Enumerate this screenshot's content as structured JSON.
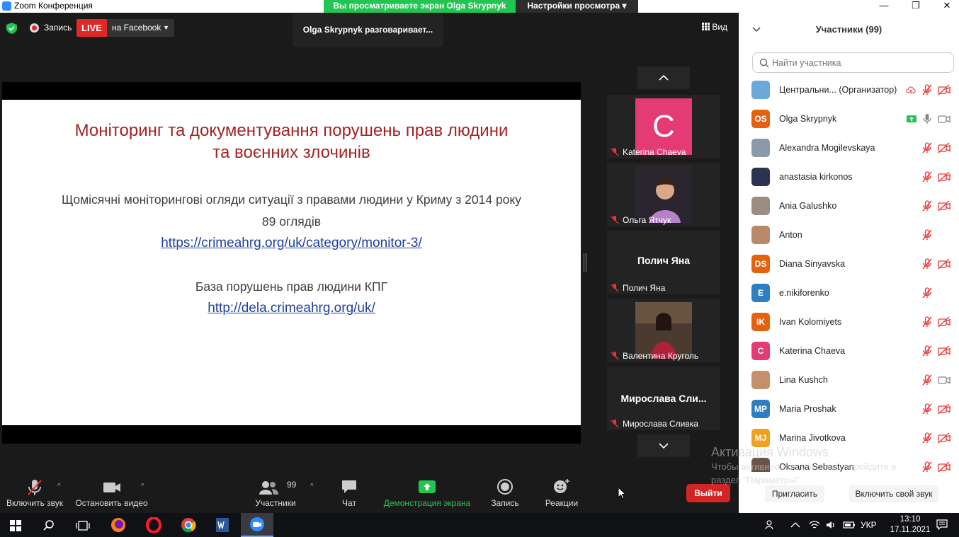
{
  "window": {
    "title": "Zoom Конференция",
    "viewing_banner": "Вы просматриваете экран Olga Skrypnyk",
    "view_options": "Настройки просмотра ▾",
    "minimize": "—",
    "maximize": "❐",
    "close": "✕"
  },
  "header": {
    "record_label": "Запись",
    "live_label": "LIVE",
    "live_target": "на Facebook",
    "speaking": "Olga Skrypnyk разговаривает...",
    "view_label": "Вид"
  },
  "slide": {
    "title_line1": "Моніторинг та документування порушень прав людини",
    "title_line2": "та воєнних злочинів",
    "line1": "Щомісячні моніторингові огляди ситуації з правами людини у Криму з 2014 року",
    "line2": "89 оглядів",
    "link1": "https://crimeahrg.org/uk/category/monitor-3/",
    "line3": "База порушень прав людини КПГ",
    "link2": "http://dela.crimeahrg.org/uk/"
  },
  "gallery": {
    "tiles": [
      {
        "name": "Katerina Chaeva",
        "avatar_letter": "C",
        "avatar_color": "#e43b75"
      },
      {
        "name": "Ольга Ятчук"
      },
      {
        "name": "Полич Яна",
        "big_label": "Полич Яна"
      },
      {
        "name": "Валентина Круголь"
      },
      {
        "name": "Мирослава Сливка",
        "big_label": "Мирослава  Сли..."
      }
    ]
  },
  "toolbar": {
    "unmute": "Включить звук",
    "stop_video": "Остановить видео",
    "participants": "Участники",
    "participants_count": "99",
    "chat": "Чат",
    "share": "Демонстрация экрана",
    "record": "Запись",
    "reactions": "Реакции",
    "leave": "Выйти"
  },
  "activation": {
    "title": "Активация Windows",
    "line1": "Чтобы активировать Windows, перейдите в",
    "line2": "раздел \"Параметры\"."
  },
  "panel": {
    "title": "Участники (99)",
    "search_placeholder": "Найти участника",
    "invite": "Пригласить",
    "unmute_me": "Включить свой звук",
    "participants": [
      {
        "name": "Центральни... (Организатор)",
        "initials": "",
        "color": "#6aa9d8",
        "mic": "muted",
        "video": "off",
        "cloud": true
      },
      {
        "name": "Olga Skrypnyk",
        "initials": "OS",
        "color": "#e4620f",
        "mic": "on",
        "video": "on",
        "share": true
      },
      {
        "name": "Alexandra Mogilevskaya",
        "initials": "",
        "color": "#8a9aa8",
        "mic": "muted",
        "video": "off"
      },
      {
        "name": "anastasia kirkonos",
        "initials": "",
        "color": "#2a3450",
        "mic": "muted",
        "video": "off"
      },
      {
        "name": "Ania Galushko",
        "initials": "",
        "color": "#9b8e80",
        "mic": "muted",
        "video": "off"
      },
      {
        "name": "Anton",
        "initials": "",
        "color": "#b98a6a",
        "mic": "muted",
        "video": "none"
      },
      {
        "name": "Diana Sinyavska",
        "initials": "DS",
        "color": "#e4620f",
        "mic": "muted",
        "video": "off"
      },
      {
        "name": "e.nikiforenko",
        "initials": "E",
        "color": "#2d7fc1",
        "mic": "muted",
        "video": "none"
      },
      {
        "name": "Ivan Kolomiyets",
        "initials": "IK",
        "color": "#e4620f",
        "mic": "muted",
        "video": "off"
      },
      {
        "name": "Katerina Chaeva",
        "initials": "C",
        "color": "#e43b75",
        "mic": "muted",
        "video": "off"
      },
      {
        "name": "Lina Kushch",
        "initials": "",
        "color": "#c48f6a",
        "mic": "muted",
        "video": "on"
      },
      {
        "name": "Maria Proshak",
        "initials": "MP",
        "color": "#2d7fc1",
        "mic": "muted",
        "video": "off"
      },
      {
        "name": "Marina Jivotkova",
        "initials": "MJ",
        "color": "#f0a020",
        "mic": "muted",
        "video": "off"
      },
      {
        "name": "Oksana Sebastyan",
        "initials": "",
        "color": "#6b5548",
        "mic": "muted",
        "video": "off"
      }
    ]
  },
  "taskbar": {
    "lang": "УКР",
    "time": "13:10",
    "date": "17.11.2021"
  }
}
